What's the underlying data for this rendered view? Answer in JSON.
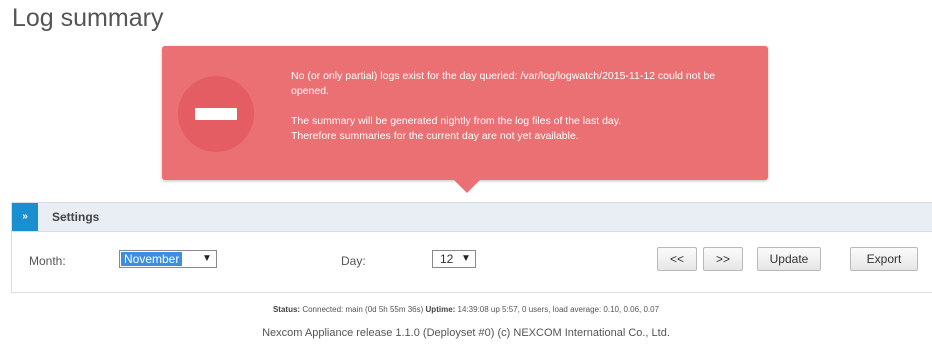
{
  "page": {
    "title": "Log summary"
  },
  "error": {
    "line1": "No (or only partial) logs exist for the day queried: /var/log/logwatch/2015-11-12 could not be opened.",
    "line2a": "The summary will be generated nightly from the log files of the last day.",
    "line2b": "Therefore summaries for the current day are not yet available.",
    "icon": "minus-circle-icon",
    "color": "#ea7074"
  },
  "settings": {
    "toggle_label": "»",
    "title": "Settings",
    "month_label": "Month:",
    "month_value": "November",
    "day_label": "Day:",
    "day_value": "12",
    "prev_label": "<<",
    "next_label": ">>",
    "update_label": "Update",
    "export_label": "Export",
    "header_color": "#e8eef4",
    "toggle_color": "#1a8fd0"
  },
  "status": {
    "status_label": "Status:",
    "status_text": "Connected: main (0d 5h 55m 36s)",
    "uptime_label": "Uptime:",
    "uptime_text": "14:39:08 up 5:57, 0 users, load average: 0.10, 0.06, 0.07"
  },
  "footer": {
    "text": "Nexcom Appliance release 1.1.0 (Deployset #0) (c) NEXCOM International Co., Ltd."
  }
}
